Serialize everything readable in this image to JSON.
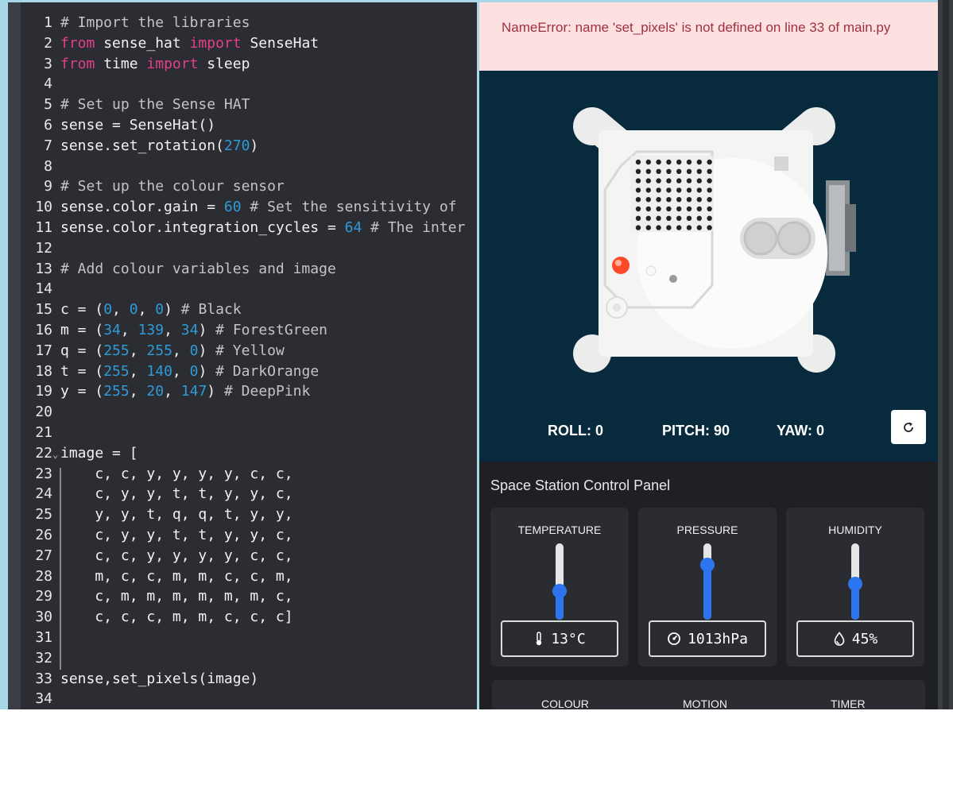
{
  "editor": {
    "lines": [
      {
        "n": "1",
        "fold": "",
        "tokens": [
          {
            "t": "# Import the libraries",
            "k": "com"
          }
        ]
      },
      {
        "n": "2",
        "fold": "",
        "tokens": [
          {
            "t": "from",
            "k": "kw"
          },
          {
            "t": " sense_hat ",
            "k": "plain"
          },
          {
            "t": "import",
            "k": "kw"
          },
          {
            "t": " SenseHat",
            "k": "plain"
          }
        ]
      },
      {
        "n": "3",
        "fold": "",
        "tokens": [
          {
            "t": "from",
            "k": "kw"
          },
          {
            "t": " time ",
            "k": "plain"
          },
          {
            "t": "import",
            "k": "kw"
          },
          {
            "t": " sleep",
            "k": "plain"
          }
        ]
      },
      {
        "n": "4",
        "fold": "",
        "tokens": []
      },
      {
        "n": "5",
        "fold": "",
        "tokens": [
          {
            "t": "# Set up the Sense HAT",
            "k": "com"
          }
        ]
      },
      {
        "n": "6",
        "fold": "",
        "tokens": [
          {
            "t": "sense = SenseHat()",
            "k": "plain"
          }
        ]
      },
      {
        "n": "7",
        "fold": "",
        "tokens": [
          {
            "t": "sense.set_rotation(",
            "k": "plain"
          },
          {
            "t": "270",
            "k": "num"
          },
          {
            "t": ")",
            "k": "plain"
          }
        ]
      },
      {
        "n": "8",
        "fold": "",
        "tokens": []
      },
      {
        "n": "9",
        "fold": "",
        "tokens": [
          {
            "t": "# Set up the colour sensor",
            "k": "com"
          }
        ]
      },
      {
        "n": "10",
        "fold": "",
        "tokens": [
          {
            "t": "sense.color.gain = ",
            "k": "plain"
          },
          {
            "t": "60",
            "k": "num"
          },
          {
            "t": " # Set the sensitivity of",
            "k": "com"
          }
        ]
      },
      {
        "n": "11",
        "fold": "",
        "tokens": [
          {
            "t": "sense.color.integration_cycles = ",
            "k": "plain"
          },
          {
            "t": "64",
            "k": "num"
          },
          {
            "t": " # The inter",
            "k": "com"
          }
        ]
      },
      {
        "n": "12",
        "fold": "",
        "tokens": []
      },
      {
        "n": "13",
        "fold": "",
        "tokens": [
          {
            "t": "# Add colour variables and image",
            "k": "com"
          }
        ]
      },
      {
        "n": "14",
        "fold": "",
        "tokens": []
      },
      {
        "n": "15",
        "fold": "",
        "tokens": [
          {
            "t": "c = (",
            "k": "plain"
          },
          {
            "t": "0",
            "k": "num"
          },
          {
            "t": ", ",
            "k": "plain"
          },
          {
            "t": "0",
            "k": "num"
          },
          {
            "t": ", ",
            "k": "plain"
          },
          {
            "t": "0",
            "k": "num"
          },
          {
            "t": ") ",
            "k": "plain"
          },
          {
            "t": "# Black",
            "k": "com"
          }
        ]
      },
      {
        "n": "16",
        "fold": "",
        "tokens": [
          {
            "t": "m = (",
            "k": "plain"
          },
          {
            "t": "34",
            "k": "num"
          },
          {
            "t": ", ",
            "k": "plain"
          },
          {
            "t": "139",
            "k": "num"
          },
          {
            "t": ", ",
            "k": "plain"
          },
          {
            "t": "34",
            "k": "num"
          },
          {
            "t": ") ",
            "k": "plain"
          },
          {
            "t": "# ForestGreen",
            "k": "com"
          }
        ]
      },
      {
        "n": "17",
        "fold": "",
        "tokens": [
          {
            "t": "q = (",
            "k": "plain"
          },
          {
            "t": "255",
            "k": "num"
          },
          {
            "t": ", ",
            "k": "plain"
          },
          {
            "t": "255",
            "k": "num"
          },
          {
            "t": ", ",
            "k": "plain"
          },
          {
            "t": "0",
            "k": "num"
          },
          {
            "t": ") ",
            "k": "plain"
          },
          {
            "t": "# Yellow",
            "k": "com"
          }
        ]
      },
      {
        "n": "18",
        "fold": "",
        "tokens": [
          {
            "t": "t = (",
            "k": "plain"
          },
          {
            "t": "255",
            "k": "num"
          },
          {
            "t": ", ",
            "k": "plain"
          },
          {
            "t": "140",
            "k": "num"
          },
          {
            "t": ", ",
            "k": "plain"
          },
          {
            "t": "0",
            "k": "num"
          },
          {
            "t": ") ",
            "k": "plain"
          },
          {
            "t": "# DarkOrange",
            "k": "com"
          }
        ]
      },
      {
        "n": "19",
        "fold": "",
        "tokens": [
          {
            "t": "y = (",
            "k": "plain"
          },
          {
            "t": "255",
            "k": "num"
          },
          {
            "t": ", ",
            "k": "plain"
          },
          {
            "t": "20",
            "k": "num"
          },
          {
            "t": ", ",
            "k": "plain"
          },
          {
            "t": "147",
            "k": "num"
          },
          {
            "t": ") ",
            "k": "plain"
          },
          {
            "t": "# DeepPink",
            "k": "com"
          }
        ]
      },
      {
        "n": "20",
        "fold": "",
        "tokens": []
      },
      {
        "n": "21",
        "fold": "",
        "tokens": []
      },
      {
        "n": "22",
        "fold": "⌄",
        "tokens": [
          {
            "t": "image = [",
            "k": "plain"
          }
        ]
      },
      {
        "n": "23",
        "fold": "",
        "tokens": [
          {
            "t": "    c, c, y, y, y, y, c, c,",
            "k": "plain"
          }
        ]
      },
      {
        "n": "24",
        "fold": "",
        "tokens": [
          {
            "t": "    c, y, y, t, t, y, y, c,",
            "k": "plain"
          }
        ]
      },
      {
        "n": "25",
        "fold": "",
        "tokens": [
          {
            "t": "    y, y, t, q, q, t, y, y,",
            "k": "plain"
          }
        ]
      },
      {
        "n": "26",
        "fold": "",
        "tokens": [
          {
            "t": "    c, y, y, t, t, y, y, c,",
            "k": "plain"
          }
        ]
      },
      {
        "n": "27",
        "fold": "",
        "tokens": [
          {
            "t": "    c, c, y, y, y, y, c, c,",
            "k": "plain"
          }
        ]
      },
      {
        "n": "28",
        "fold": "",
        "tokens": [
          {
            "t": "    m, c, c, m, m, c, c, m,",
            "k": "plain"
          }
        ]
      },
      {
        "n": "29",
        "fold": "",
        "tokens": [
          {
            "t": "    c, m, m, m, m, m, m, c,",
            "k": "plain"
          }
        ]
      },
      {
        "n": "30",
        "fold": "",
        "tokens": [
          {
            "t": "    c, c, c, m, m, c, c, c]",
            "k": "plain"
          }
        ]
      },
      {
        "n": "31",
        "fold": "",
        "tokens": []
      },
      {
        "n": "32",
        "fold": "",
        "tokens": []
      },
      {
        "n": "33",
        "fold": "",
        "tokens": [
          {
            "t": "sense,set_pixels(image)",
            "k": "plain"
          }
        ]
      },
      {
        "n": "34",
        "fold": "",
        "tokens": []
      }
    ]
  },
  "error": {
    "message": "NameError: name 'set_pixels' is not defined on line 33 of main.py"
  },
  "emulator": {
    "roll": "ROLL: 0",
    "pitch": "PITCH: 90",
    "yaw": "YAW: 0",
    "reset_icon": "refresh-icon"
  },
  "panel": {
    "title": "Space Station Control Panel",
    "sensors": [
      {
        "label": "TEMPERATURE",
        "value": "13°C",
        "icon": "thermometer-icon",
        "level": 0.38
      },
      {
        "label": "PRESSURE",
        "value": "1013hPa",
        "icon": "gauge-icon",
        "level": 0.72
      },
      {
        "label": "HUMIDITY",
        "value": "45%",
        "icon": "droplet-icon",
        "level": 0.47
      }
    ],
    "bottom_tabs": [
      "COLOUR",
      "MOTION",
      "TIMER"
    ]
  },
  "colors": {
    "keyword": "#e0408a",
    "number": "#2f9bd6",
    "comment": "#c4c4c4",
    "error_bg": "#fde1e1",
    "error_text": "#a03040",
    "emulator_bg": "#072a3d",
    "slider_accent": "#2c74f0"
  }
}
